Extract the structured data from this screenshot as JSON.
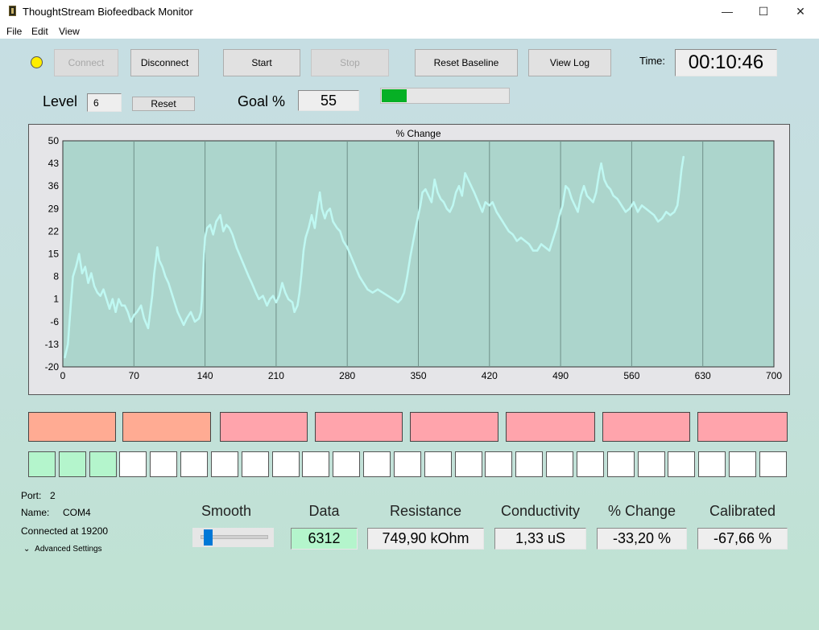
{
  "window": {
    "title": "ThoughtStream Biofeedback Monitor",
    "minimize": "—",
    "maximize": "☐",
    "close": "✕"
  },
  "menu": [
    "File",
    "Edit",
    "View"
  ],
  "toolbar": {
    "connect": "Connect",
    "disconnect": "Disconnect",
    "start": "Start",
    "stop": "Stop",
    "reset_baseline": "Reset Baseline",
    "view_log": "View Log",
    "time_label": "Time:",
    "time_value": "00:10:46"
  },
  "level": {
    "label": "Level",
    "value": "6",
    "reset": "Reset"
  },
  "goal": {
    "label": "Goal %",
    "value": "55",
    "progress": 0.2
  },
  "colors": {
    "series": "#bff8f2",
    "plot_bg": "#acd5cc",
    "led": "#ffee00",
    "zone_orange": "#ffab93",
    "zone_pink": "#ffa4ac",
    "cell_on": "#b4f5cc"
  },
  "chart_data": {
    "type": "scatter",
    "title": "% Change",
    "xlim": [
      0,
      700
    ],
    "ylim": [
      -20,
      50
    ],
    "x_ticks": [
      0,
      70,
      140,
      210,
      280,
      350,
      420,
      490,
      560,
      630,
      700
    ],
    "y_ticks": [
      50,
      43,
      36,
      29,
      22,
      15,
      8,
      1,
      -6,
      -13,
      -20
    ],
    "grid": true,
    "series": [
      {
        "points": [
          [
            2,
            -17
          ],
          [
            5,
            -13
          ],
          [
            8,
            0
          ],
          [
            10,
            8
          ],
          [
            13,
            11
          ],
          [
            16,
            15
          ],
          [
            19,
            9
          ],
          [
            22,
            11
          ],
          [
            25,
            6
          ],
          [
            28,
            9
          ],
          [
            31,
            5
          ],
          [
            34,
            3
          ],
          [
            37,
            2
          ],
          [
            40,
            4
          ],
          [
            43,
            1
          ],
          [
            46,
            -2
          ],
          [
            49,
            1
          ],
          [
            52,
            -3
          ],
          [
            55,
            1
          ],
          [
            58,
            -1
          ],
          [
            61,
            -1
          ],
          [
            64,
            -3
          ],
          [
            67,
            -6
          ],
          [
            70,
            -4
          ],
          [
            73,
            -3
          ],
          [
            77,
            -1
          ],
          [
            80,
            -5
          ],
          [
            84,
            -8
          ],
          [
            86,
            -3
          ],
          [
            88,
            2
          ],
          [
            90,
            9
          ],
          [
            92,
            14
          ],
          [
            93,
            17
          ],
          [
            95,
            13
          ],
          [
            98,
            11
          ],
          [
            101,
            8
          ],
          [
            104,
            6
          ],
          [
            107,
            3
          ],
          [
            110,
            0
          ],
          [
            113,
            -3
          ],
          [
            116,
            -5
          ],
          [
            119,
            -7
          ],
          [
            122,
            -5
          ],
          [
            126,
            -3
          ],
          [
            130,
            -6
          ],
          [
            134,
            -5
          ],
          [
            136,
            -3
          ],
          [
            137,
            1
          ],
          [
            138,
            8
          ],
          [
            139,
            15
          ],
          [
            140,
            20
          ],
          [
            142,
            23
          ],
          [
            145,
            24
          ],
          [
            148,
            21
          ],
          [
            151,
            25
          ],
          [
            155,
            27
          ],
          [
            158,
            22
          ],
          [
            161,
            24
          ],
          [
            164,
            23
          ],
          [
            167,
            21
          ],
          [
            171,
            17
          ],
          [
            175,
            14
          ],
          [
            179,
            11
          ],
          [
            183,
            8
          ],
          [
            186,
            6
          ],
          [
            190,
            3
          ],
          [
            193,
            1
          ],
          [
            197,
            2
          ],
          [
            201,
            -1
          ],
          [
            204,
            1
          ],
          [
            207,
            2
          ],
          [
            210,
            0
          ],
          [
            213,
            2
          ],
          [
            216,
            6
          ],
          [
            219,
            3
          ],
          [
            222,
            1
          ],
          [
            226,
            0
          ],
          [
            228,
            -3
          ],
          [
            231,
            -1
          ],
          [
            233,
            3
          ],
          [
            235,
            9
          ],
          [
            237,
            16
          ],
          [
            239,
            20
          ],
          [
            242,
            23
          ],
          [
            245,
            27
          ],
          [
            248,
            23
          ],
          [
            251,
            30
          ],
          [
            253,
            34
          ],
          [
            255,
            29
          ],
          [
            258,
            26
          ],
          [
            260,
            28
          ],
          [
            263,
            29
          ],
          [
            266,
            25
          ],
          [
            270,
            23
          ],
          [
            273,
            22
          ],
          [
            276,
            19
          ],
          [
            280,
            17
          ],
          [
            284,
            14
          ],
          [
            288,
            11
          ],
          [
            292,
            8
          ],
          [
            296,
            6
          ],
          [
            300,
            4
          ],
          [
            305,
            3
          ],
          [
            310,
            4
          ],
          [
            315,
            3
          ],
          [
            320,
            2
          ],
          [
            325,
            1
          ],
          [
            330,
            0
          ],
          [
            333,
            1
          ],
          [
            336,
            3
          ],
          [
            339,
            8
          ],
          [
            342,
            14
          ],
          [
            345,
            19
          ],
          [
            348,
            24
          ],
          [
            350,
            27
          ],
          [
            352,
            30
          ],
          [
            354,
            34
          ],
          [
            357,
            35
          ],
          [
            360,
            33
          ],
          [
            363,
            31
          ],
          [
            366,
            38
          ],
          [
            369,
            34
          ],
          [
            372,
            32
          ],
          [
            375,
            31
          ],
          [
            378,
            29
          ],
          [
            381,
            28
          ],
          [
            384,
            30
          ],
          [
            387,
            34
          ],
          [
            390,
            36
          ],
          [
            393,
            33
          ],
          [
            396,
            40
          ],
          [
            399,
            38
          ],
          [
            402,
            36
          ],
          [
            405,
            34
          ],
          [
            409,
            31
          ],
          [
            413,
            28
          ],
          [
            416,
            31
          ],
          [
            420,
            30
          ],
          [
            423,
            31
          ],
          [
            427,
            28
          ],
          [
            431,
            26
          ],
          [
            435,
            24
          ],
          [
            439,
            22
          ],
          [
            443,
            21
          ],
          [
            447,
            19
          ],
          [
            451,
            20
          ],
          [
            455,
            19
          ],
          [
            459,
            18
          ],
          [
            463,
            16
          ],
          [
            467,
            16
          ],
          [
            471,
            18
          ],
          [
            475,
            17
          ],
          [
            479,
            16
          ],
          [
            483,
            20
          ],
          [
            486,
            23
          ],
          [
            489,
            27
          ],
          [
            492,
            30
          ],
          [
            495,
            36
          ],
          [
            498,
            35
          ],
          [
            501,
            32
          ],
          [
            504,
            30
          ],
          [
            507,
            28
          ],
          [
            510,
            33
          ],
          [
            513,
            36
          ],
          [
            516,
            33
          ],
          [
            519,
            32
          ],
          [
            522,
            31
          ],
          [
            525,
            34
          ],
          [
            528,
            40
          ],
          [
            530,
            43
          ],
          [
            533,
            38
          ],
          [
            536,
            36
          ],
          [
            539,
            35
          ],
          [
            542,
            33
          ],
          [
            546,
            32
          ],
          [
            550,
            30
          ],
          [
            554,
            28
          ],
          [
            558,
            29
          ],
          [
            562,
            31
          ],
          [
            566,
            28
          ],
          [
            570,
            30
          ],
          [
            574,
            29
          ],
          [
            578,
            28
          ],
          [
            582,
            27
          ],
          [
            586,
            25
          ],
          [
            590,
            26
          ],
          [
            594,
            28
          ],
          [
            598,
            27
          ],
          [
            602,
            28
          ],
          [
            605,
            30
          ],
          [
            607,
            35
          ],
          [
            609,
            41
          ],
          [
            611,
            45
          ]
        ]
      }
    ]
  },
  "zones": [
    "orange",
    "orange",
    "pink",
    "pink",
    "pink",
    "pink",
    "pink",
    "pink"
  ],
  "cells": [
    true,
    true,
    true,
    false,
    false,
    false,
    false,
    false,
    false,
    false,
    false,
    false,
    false,
    false,
    false,
    false,
    false,
    false,
    false,
    false,
    false,
    false,
    false,
    false,
    false
  ],
  "port": {
    "port_label": "Port:",
    "port_value": "2",
    "name_label": "Name:",
    "name_value": "COM4",
    "connected": "Connected at 19200",
    "advanced": "Advanced Settings"
  },
  "smooth": {
    "label": "Smooth",
    "value": 0.08
  },
  "stats": {
    "data": {
      "label": "Data",
      "value": "6312"
    },
    "resistance": {
      "label": "Resistance",
      "value": "749,90 kOhm"
    },
    "conductivity": {
      "label": "Conductivity",
      "value": "1,33 uS"
    },
    "pct_change": {
      "label": "% Change",
      "value": "-33,20 %"
    },
    "calibrated": {
      "label": "Calibrated",
      "value": "-67,66 %"
    }
  }
}
